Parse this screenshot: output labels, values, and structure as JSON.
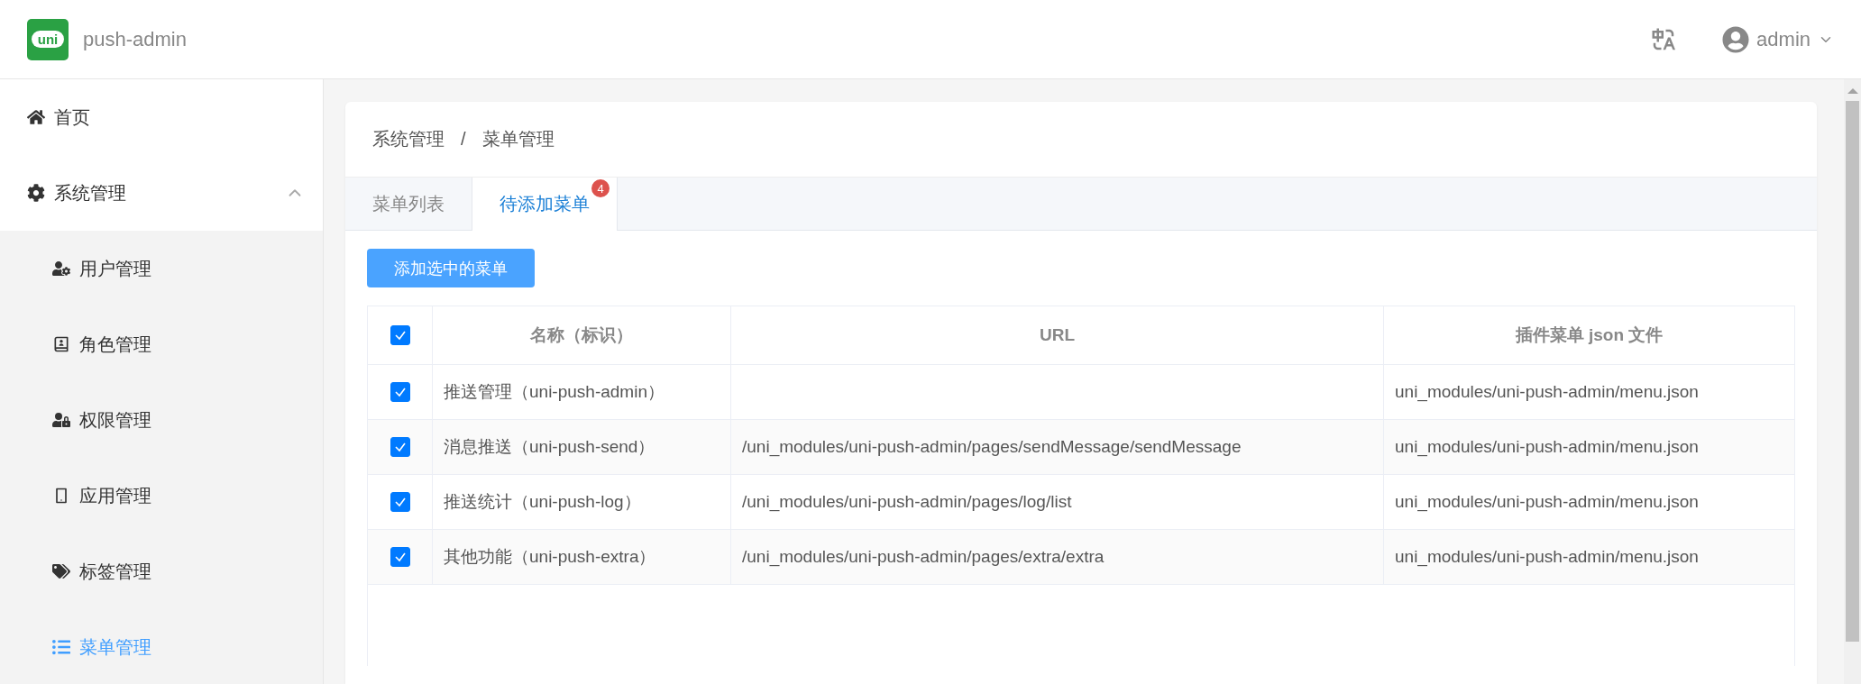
{
  "header": {
    "app_name": "push-admin",
    "logo_text": "uni",
    "user": "admin"
  },
  "sidebar": {
    "items": [
      {
        "label": "首页",
        "selected": false
      },
      {
        "label": "系统管理",
        "selected": false,
        "expanded": true,
        "children": [
          {
            "label": "用户管理",
            "selected": false
          },
          {
            "label": "角色管理",
            "selected": false
          },
          {
            "label": "权限管理",
            "selected": false
          },
          {
            "label": "应用管理",
            "selected": false
          },
          {
            "label": "标签管理",
            "selected": false
          },
          {
            "label": "菜单管理",
            "selected": true
          }
        ]
      }
    ]
  },
  "breadcrumb": [
    "系统管理",
    "菜单管理"
  ],
  "breadcrumb_separator": "/",
  "tabs": [
    {
      "label": "菜单列表",
      "selected": false
    },
    {
      "label": "待添加菜单",
      "selected": true,
      "badge": "4"
    }
  ],
  "add_button": "添加选中的菜单",
  "table": {
    "all_checked": true,
    "columns": [
      "名称（标识）",
      "URL",
      "插件菜单 json 文件"
    ],
    "rows": [
      {
        "checked": true,
        "cells": [
          "推送管理（uni-push-admin）",
          "",
          "uni_modules/uni-push-admin/menu.json"
        ]
      },
      {
        "checked": true,
        "cells": [
          "消息推送（uni-push-send）",
          "/uni_modules/uni-push-admin/pages/sendMessage/sendMessage",
          "uni_modules/uni-push-admin/menu.json"
        ]
      },
      {
        "checked": true,
        "cells": [
          "推送统计（uni-push-log）",
          "/uni_modules/uni-push-admin/pages/log/list",
          "uni_modules/uni-push-admin/menu.json"
        ]
      },
      {
        "checked": true,
        "cells": [
          "其他功能（uni-push-extra）",
          "/uni_modules/uni-push-admin/pages/extra/extra",
          "uni_modules/uni-push-admin/menu.json"
        ]
      }
    ]
  }
}
